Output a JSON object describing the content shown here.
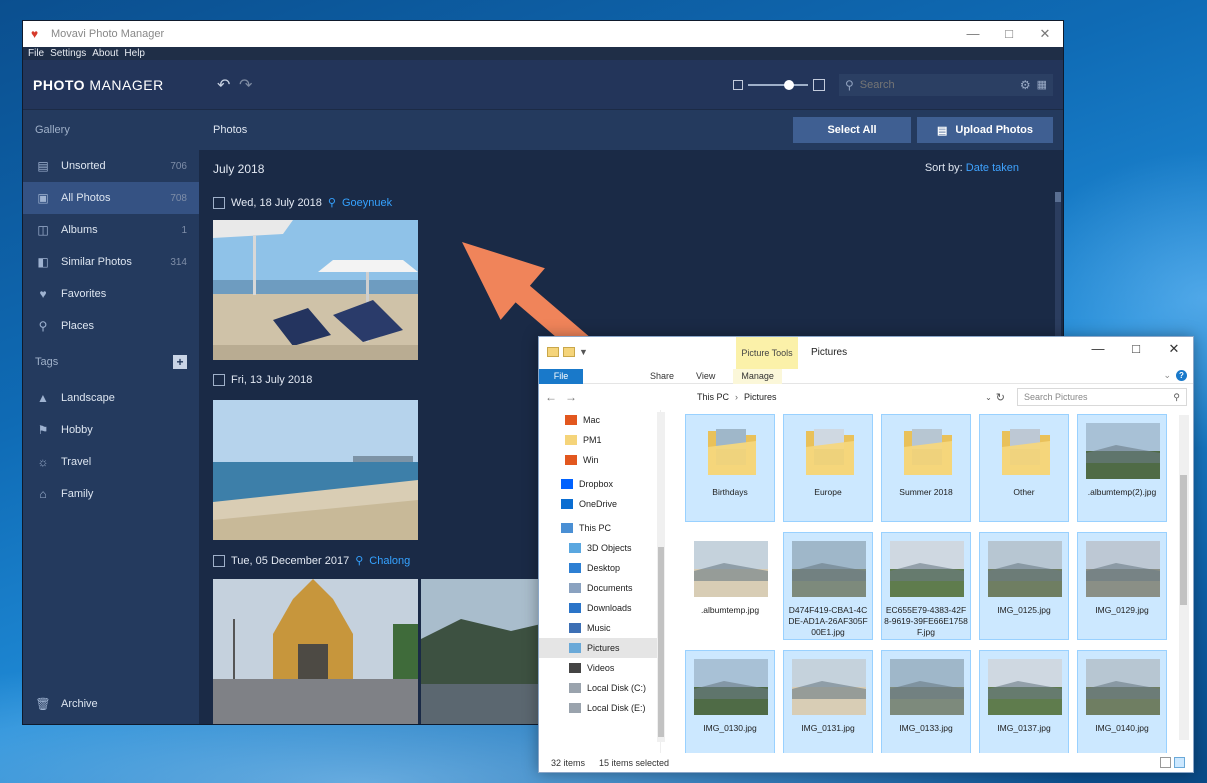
{
  "photo_manager": {
    "window_title": "Movavi Photo Manager",
    "menu": [
      "File",
      "Settings",
      "About",
      "Help"
    ],
    "logo_bold": "PHOTO",
    "logo_light": " MANAGER",
    "search_placeholder": "Search",
    "sidebar": {
      "gallery_heading": "Gallery",
      "items": [
        {
          "label": "Unsorted",
          "count": "706",
          "icon": "unsorted-icon"
        },
        {
          "label": "All Photos",
          "count": "708",
          "icon": "photos-icon"
        },
        {
          "label": "Albums",
          "count": "1",
          "icon": "albums-icon"
        },
        {
          "label": "Similar Photos",
          "count": "314",
          "icon": "similar-icon"
        },
        {
          "label": "Favorites",
          "count": "",
          "icon": "heart-icon"
        },
        {
          "label": "Places",
          "count": "",
          "icon": "pin-icon"
        }
      ],
      "tags_heading": "Tags",
      "tags": [
        {
          "label": "Landscape",
          "icon": "landscape-icon"
        },
        {
          "label": "Hobby",
          "icon": "hobby-icon"
        },
        {
          "label": "Travel",
          "icon": "travel-icon"
        },
        {
          "label": "Family",
          "icon": "family-icon"
        }
      ],
      "archive_label": "Archive"
    },
    "main": {
      "title": "Photos",
      "select_all": "Select All",
      "upload": "Upload Photos",
      "month": "July 2018",
      "sort_prefix": "Sort by:",
      "sort_value": "Date taken",
      "days": [
        {
          "date": "Wed, 18 July 2018",
          "location": "Goeynuek"
        },
        {
          "date": "Fri, 13 July 2018",
          "location": ""
        },
        {
          "date": "Tue, 05 December 2017",
          "location": "Chalong"
        }
      ]
    }
  },
  "explorer": {
    "window_title": "Pictures",
    "picture_tools": "Picture Tools",
    "ribbon_tabs": [
      "File",
      "Share",
      "View",
      "Manage"
    ],
    "path": [
      "This PC",
      "Pictures"
    ],
    "search_placeholder": "Search Pictures",
    "nav_items": [
      {
        "label": "Mac",
        "icon": "office-icon"
      },
      {
        "label": "PM1",
        "icon": "folder-icon"
      },
      {
        "label": "Win",
        "icon": "office-icon"
      },
      {
        "label": "Dropbox",
        "icon": "dropbox-icon"
      },
      {
        "label": "OneDrive",
        "icon": "onedrive-icon"
      },
      {
        "label": "This PC",
        "icon": "pc-icon"
      },
      {
        "label": "3D Objects",
        "icon": "objects-icon"
      },
      {
        "label": "Desktop",
        "icon": "desktop-icon"
      },
      {
        "label": "Documents",
        "icon": "documents-icon"
      },
      {
        "label": "Downloads",
        "icon": "downloads-icon"
      },
      {
        "label": "Music",
        "icon": "music-icon"
      },
      {
        "label": "Pictures",
        "icon": "pictures-icon"
      },
      {
        "label": "Videos",
        "icon": "videos-icon"
      },
      {
        "label": "Local Disk (C:)",
        "icon": "disk-icon"
      },
      {
        "label": "Local Disk (E:)",
        "icon": "disk-icon"
      }
    ],
    "files": [
      {
        "name": "Birthdays",
        "kind": "folder",
        "selected": true
      },
      {
        "name": "Europe",
        "kind": "folder",
        "selected": true
      },
      {
        "name": "Summer 2018",
        "kind": "folder",
        "selected": true
      },
      {
        "name": "Other",
        "kind": "folder",
        "selected": true
      },
      {
        "name": ".albumtemp(2).jpg",
        "kind": "image",
        "selected": true
      },
      {
        "name": ".albumtemp.jpg",
        "kind": "image",
        "selected": false
      },
      {
        "name": "D474F419-CBA1-4CDE-AD1A-26AF305F00E1.jpg",
        "kind": "image",
        "selected": true
      },
      {
        "name": "EC655E79-4383-42F8-9619-39FE66E1758F.jpg",
        "kind": "image",
        "selected": true
      },
      {
        "name": "IMG_0125.jpg",
        "kind": "image",
        "selected": true
      },
      {
        "name": "IMG_0129.jpg",
        "kind": "image",
        "selected": true
      },
      {
        "name": "IMG_0130.jpg",
        "kind": "image",
        "selected": true
      },
      {
        "name": "IMG_0131.jpg",
        "kind": "image",
        "selected": true
      },
      {
        "name": "IMG_0133.jpg",
        "kind": "image",
        "selected": true
      },
      {
        "name": "IMG_0137.jpg",
        "kind": "image",
        "selected": true
      },
      {
        "name": "IMG_0140.jpg",
        "kind": "image",
        "selected": true
      }
    ],
    "status_items": "32 items",
    "status_selected": "15 items selected"
  },
  "colors": {
    "accent": "#3fa3ff",
    "drag_arrow": "#f0845a",
    "selection": "#cce8ff"
  }
}
